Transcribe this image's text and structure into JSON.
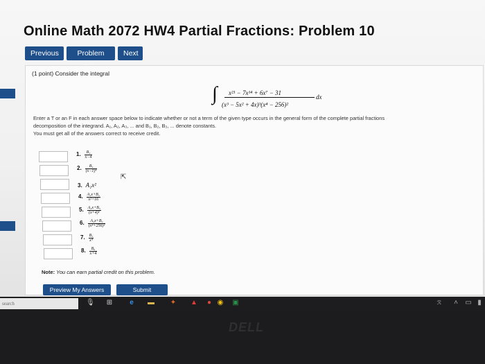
{
  "page": {
    "title": "Online Math 2072 HW4 Partial Fractions: Problem 10"
  },
  "nav": {
    "previous": "Previous",
    "problem_list": "Problem List",
    "next": "Next"
  },
  "problem": {
    "points_text": "(1 point) Consider the integral",
    "integral": {
      "numerator": "x²¹ − 7x¹⁴ + 6x⁷ − 31",
      "denominator": "(x³ − 5x² + 4x)³(x⁴ − 256)²",
      "differential": "dx"
    },
    "instructions": [
      "Enter a T or an F in each answer space below to indicate whether or not a term of the given type occurs in the general form of the complete partial fractions",
      "decomposition of the integrand. A₁, A₂, A₃, ... and B₁, B₂, B₃, ... denote constants.",
      "You must get all of the answers correct to receive credit."
    ],
    "items": [
      {
        "num": "1.",
        "n": "B₁",
        "d": "x−4"
      },
      {
        "num": "2.",
        "n": "B₄",
        "d": "(x−1)⁴"
      },
      {
        "num": "3.",
        "plain": "A₁x²"
      },
      {
        "num": "4.",
        "n": "A₂x+B₂",
        "d": "x²+16"
      },
      {
        "num": "5.",
        "n": "A₃x+B₃",
        "d": "(x+4)²"
      },
      {
        "num": "6.",
        "n": "A₄x+B₄",
        "d": "(x⁴+256)²"
      },
      {
        "num": "7.",
        "n": "B₅",
        "d": "x⁴"
      },
      {
        "num": "8.",
        "n": "B₆",
        "d": "x+4"
      }
    ],
    "answers": [
      "",
      "",
      "",
      "",
      "",
      "",
      "",
      ""
    ],
    "note_label": "Note:",
    "note_text": "You can earn partial credit on this problem."
  },
  "actions": {
    "preview": "Preview My Answers",
    "submit": "Submit Answers"
  },
  "taskbar": {
    "search_placeholder": "search"
  },
  "colors": {
    "button_blue": "#1e4f8a"
  }
}
